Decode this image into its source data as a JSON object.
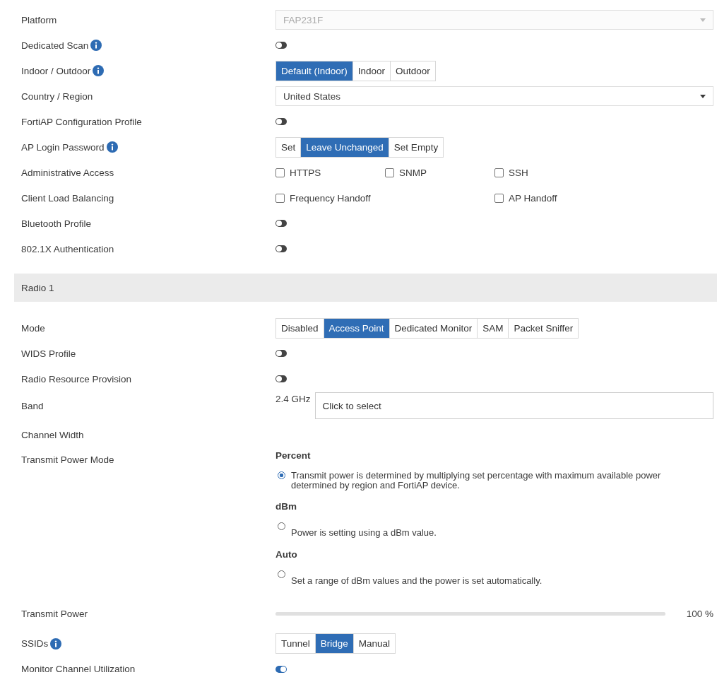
{
  "general": {
    "rows": [
      {
        "kind": "select",
        "label": "Platform",
        "info": false,
        "value": "FAP231F",
        "disabled": true
      },
      {
        "kind": "toggle",
        "label": "Dedicated Scan",
        "info": true,
        "on": false
      },
      {
        "kind": "segmented",
        "label": "Indoor / Outdoor",
        "info": true,
        "options": [
          {
            "label": "Default (Indoor)",
            "selected": true
          },
          {
            "label": "Indoor",
            "selected": false
          },
          {
            "label": "Outdoor",
            "selected": false
          }
        ]
      },
      {
        "kind": "select",
        "label": "Country / Region",
        "info": false,
        "value": "United States",
        "disabled": false
      },
      {
        "kind": "toggle",
        "label": "FortiAP Configuration Profile",
        "info": false,
        "on": false
      },
      {
        "kind": "segmented",
        "label": "AP Login Password",
        "info": true,
        "options": [
          {
            "label": "Set",
            "selected": false
          },
          {
            "label": "Leave Unchanged",
            "selected": true
          },
          {
            "label": "Set Empty",
            "selected": false
          }
        ]
      },
      {
        "kind": "checkboxes",
        "label": "Administrative Access",
        "info": false,
        "items": [
          {
            "label": "HTTPS",
            "checked": false
          },
          {
            "label": "SNMP",
            "checked": false
          },
          {
            "label": "SSH",
            "checked": false
          }
        ]
      },
      {
        "kind": "checkboxes",
        "label": "Client Load Balancing",
        "info": false,
        "items": [
          {
            "label": "Frequency Handoff",
            "checked": false
          },
          {
            "label": "AP Handoff",
            "checked": false
          }
        ]
      },
      {
        "kind": "toggle",
        "label": "Bluetooth Profile",
        "info": false,
        "on": false
      },
      {
        "kind": "toggle",
        "label": "802.1X Authentication",
        "info": false,
        "on": false
      }
    ]
  },
  "radio_section": {
    "title": "Radio 1",
    "rows": [
      {
        "kind": "segmented",
        "label": "Mode",
        "info": false,
        "options": [
          {
            "label": "Disabled",
            "selected": false
          },
          {
            "label": "Access Point",
            "selected": true
          },
          {
            "label": "Dedicated Monitor",
            "selected": false
          },
          {
            "label": "SAM",
            "selected": false
          },
          {
            "label": "Packet Sniffer",
            "selected": false
          }
        ]
      },
      {
        "kind": "toggle",
        "label": "WIDS Profile",
        "info": false,
        "on": false
      },
      {
        "kind": "toggle",
        "label": "Radio Resource Provision",
        "info": false,
        "on": false
      },
      {
        "kind": "band",
        "label": "Band",
        "info": false,
        "band": "2.4 GHz",
        "placeholder": "Click to select"
      },
      {
        "kind": "empty",
        "label": "Channel Width",
        "info": false
      },
      {
        "kind": "radios",
        "label": "Transmit Power Mode",
        "info": false,
        "options": [
          {
            "title": "Percent",
            "description": "Transmit power is determined by multiplying set percentage with maximum available power determined by region and FortiAP device.",
            "selected": true
          },
          {
            "title": "dBm",
            "description": "Power is setting using a dBm value.",
            "selected": false
          },
          {
            "title": "Auto",
            "description": "Set a range of dBm values and the power is set automatically.",
            "selected": false
          }
        ]
      },
      {
        "kind": "slider",
        "label": "Transmit Power",
        "info": false,
        "level": 1,
        "reading": "100 %"
      },
      {
        "kind": "segmented",
        "label": "SSIDs",
        "info": true,
        "options": [
          {
            "label": "Tunnel",
            "selected": false
          },
          {
            "label": "Bridge",
            "selected": true
          },
          {
            "label": "Manual",
            "selected": false
          }
        ]
      },
      {
        "kind": "toggle",
        "label": "Monitor Channel Utilization",
        "info": false,
        "on": true
      }
    ]
  }
}
